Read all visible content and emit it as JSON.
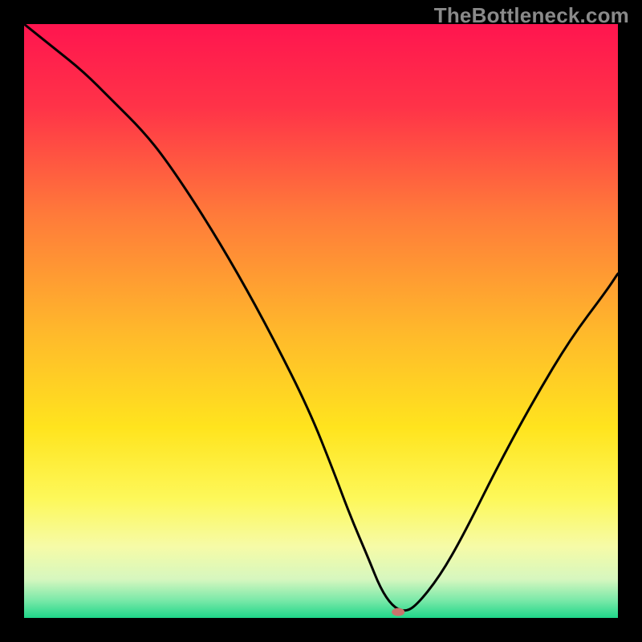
{
  "watermark": "TheBottleneck.com",
  "chart_data": {
    "type": "line",
    "title": "",
    "xlabel": "",
    "ylabel": "",
    "xlim": [
      0,
      100
    ],
    "ylim": [
      0,
      100
    ],
    "legend": false,
    "grid": false,
    "background_gradient_stops": [
      {
        "pct": 0.0,
        "color": "#ff154f"
      },
      {
        "pct": 0.14,
        "color": "#ff3348"
      },
      {
        "pct": 0.32,
        "color": "#ff7a3a"
      },
      {
        "pct": 0.52,
        "color": "#ffb92b"
      },
      {
        "pct": 0.68,
        "color": "#ffe41e"
      },
      {
        "pct": 0.8,
        "color": "#fdf85a"
      },
      {
        "pct": 0.88,
        "color": "#f6fba7"
      },
      {
        "pct": 0.935,
        "color": "#d6f7bf"
      },
      {
        "pct": 0.97,
        "color": "#7be9a9"
      },
      {
        "pct": 1.0,
        "color": "#1fd689"
      }
    ],
    "curve_color": "#000000",
    "series": [
      {
        "name": "bottleneck_curve",
        "x": [
          0,
          5,
          10,
          15,
          20,
          24,
          30,
          36,
          42,
          48,
          52,
          55,
          58,
          60,
          62,
          64,
          66,
          70,
          74,
          80,
          86,
          92,
          98,
          100
        ],
        "y": [
          100,
          96,
          92,
          87,
          82,
          77,
          68,
          58,
          47,
          35,
          25,
          17,
          10,
          5,
          2,
          1,
          2,
          7,
          14,
          26,
          37,
          47,
          55,
          58
        ]
      }
    ],
    "marker": {
      "x": 63,
      "y": 1,
      "color": "#c9746c",
      "rx": 8,
      "ry": 5
    }
  }
}
